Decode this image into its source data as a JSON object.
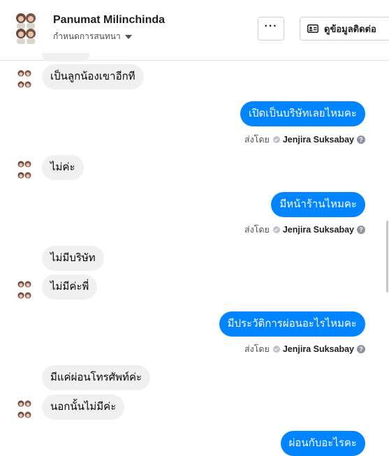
{
  "header": {
    "name": "Panumat Milinchinda",
    "assign": "กำหนดการสนทนา",
    "more_label": "···",
    "contact_label": "ดูข้อมูลติดต่อ"
  },
  "messages": [
    {
      "text": "เป็นลูกน้องเขาอีกที"
    },
    {
      "text": "เปิดเป็นบริษัทเลยไหมคะ"
    },
    {
      "text": "ไม่ค่ะ"
    },
    {
      "text": "มีหน้าร้านไหมคะ"
    },
    {
      "text": "ไม่มีบริษัท"
    },
    {
      "text": "ไม่มีค่ะพี่"
    },
    {
      "text": "มีประวัติการผ่อนอะไรไหมคะ"
    },
    {
      "text": "มีแค่ผ่อนโทรศัพท์ค่ะ"
    },
    {
      "text": "นอกนั้นไม่มีค่ะ"
    },
    {
      "text": "ผ่อนกับอะไรคะ"
    }
  ],
  "sent_by": {
    "prefix": "ส่งโดย",
    "agent": "Jenjira Suksabay",
    "help": "?"
  },
  "colors": {
    "outgoing": "#0084ff",
    "incoming": "#f0f0f0"
  }
}
